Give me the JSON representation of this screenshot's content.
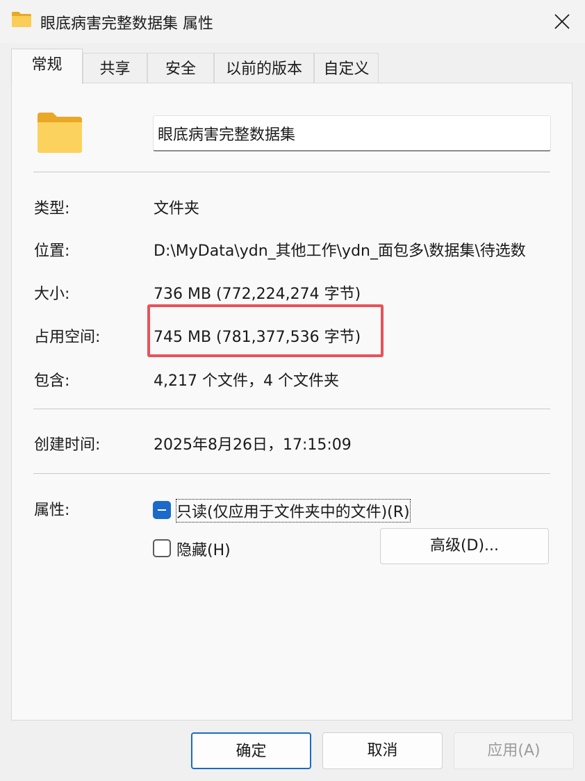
{
  "window": {
    "title": "眼底病害完整数据集 属性",
    "folder_icon": "folder-icon",
    "close_icon": "close-icon"
  },
  "tabs": [
    {
      "label": "常规",
      "active": true
    },
    {
      "label": "共享",
      "active": false
    },
    {
      "label": "安全",
      "active": false
    },
    {
      "label": "以前的版本",
      "active": false
    },
    {
      "label": "自定义",
      "active": false
    }
  ],
  "general": {
    "folder_name": "眼底病害完整数据集",
    "type_label": "类型:",
    "type_value": "文件夹",
    "location_label": "位置:",
    "location_value": "D:\\MyData\\ydn_其他工作\\ydn_面包多\\数据集\\待选数",
    "size_label": "大小:",
    "size_value": "736 MB (772,224,274 字节)",
    "size_on_disk_label": "占用空间:",
    "size_on_disk_value": "745 MB (781,377,536 字节)",
    "contains_label": "包含:",
    "contains_value": "4,217 个文件，4 个文件夹",
    "created_label": "创建时间:",
    "created_value": "2025年8月26日，17:15:09",
    "attributes_label": "属性:",
    "readonly_label": "只读(仅应用于文件夹中的文件)(R)",
    "readonly_state": "indeterminate",
    "hidden_label": "隐藏(H)",
    "hidden_state": "unchecked",
    "advanced_button": "高级(D)..."
  },
  "footer": {
    "ok": "确定",
    "cancel": "取消",
    "apply": "应用(A)"
  },
  "colors": {
    "accent": "#1b6ac9",
    "highlight_box": "#e8525a",
    "folder": "#f7c948"
  }
}
